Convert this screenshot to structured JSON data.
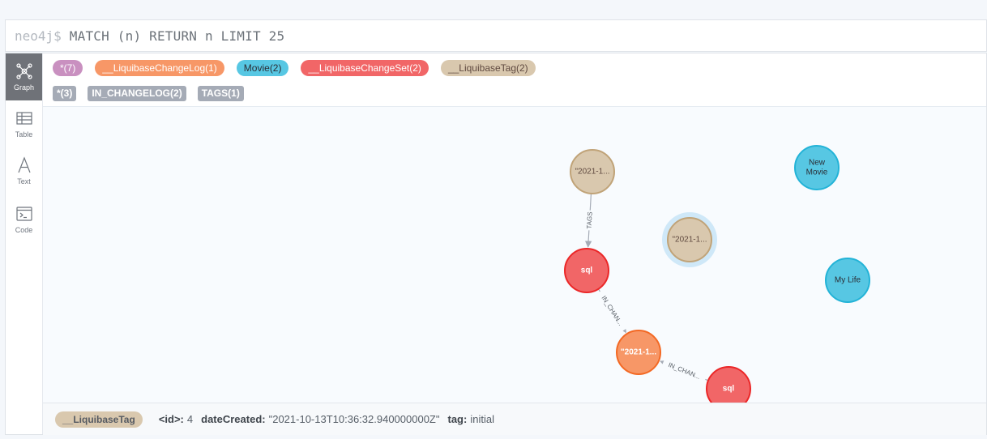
{
  "editor": {
    "prompt": "neo4j$",
    "query": "MATCH (n) RETURN n LIMIT 25"
  },
  "sidebar": {
    "modes": [
      {
        "label": "Graph",
        "icon": "graph-icon",
        "active": true
      },
      {
        "label": "Table",
        "icon": "table-icon",
        "active": false
      },
      {
        "label": "Text",
        "icon": "text-icon",
        "active": false
      },
      {
        "label": "Code",
        "icon": "code-icon",
        "active": false
      }
    ]
  },
  "labels": [
    {
      "name": "*",
      "count": "(7)",
      "bg": "#c990c0",
      "fg": "#ffffff"
    },
    {
      "name": "__LiquibaseChangeLog",
      "count": "(1)",
      "bg": "#f79767",
      "fg": "#ffffff"
    },
    {
      "name": "Movie",
      "count": "(2)",
      "bg": "#57c7e3",
      "fg": "#2a2c34"
    },
    {
      "name": "__LiquibaseChangeSet",
      "count": "(2)",
      "bg": "#f16667",
      "fg": "#ffffff"
    },
    {
      "name": "__LiquibaseTag",
      "count": "(2)",
      "bg": "#d9c8ae",
      "fg": "#604a40"
    }
  ],
  "relationships": [
    {
      "name": "*",
      "count": "(3)"
    },
    {
      "name": "IN_CHANGELOG",
      "count": "(2)"
    },
    {
      "name": "TAGS",
      "count": "(1)"
    }
  ],
  "graph": {
    "nodes": [
      {
        "id": "tag1",
        "caption": "\"2021-1...",
        "fill": "#d9c8ae",
        "stroke": "#c0a378",
        "text": "#604a40",
        "selected": false
      },
      {
        "id": "tag2",
        "caption": "\"2021-1...",
        "fill": "#d9c8ae",
        "stroke": "#c0a378",
        "text": "#604a40",
        "selected": true
      },
      {
        "id": "movie1",
        "caption": "New Movie",
        "fill": "#57c7e3",
        "stroke": "#23b3d7",
        "text": "#2a2c34",
        "selected": false
      },
      {
        "id": "movie2",
        "caption": "My Life",
        "fill": "#57c7e3",
        "stroke": "#23b3d7",
        "text": "#2a2c34",
        "selected": false
      },
      {
        "id": "set1",
        "caption": "sql",
        "fill": "#f16667",
        "stroke": "#eb2728",
        "text": "#ffffff",
        "selected": false
      },
      {
        "id": "log1",
        "caption": "\"2021-1...",
        "fill": "#f79767",
        "stroke": "#f36924",
        "text": "#ffffff",
        "selected": false
      },
      {
        "id": "set2",
        "caption": "sql",
        "fill": "#f16667",
        "stroke": "#eb2728",
        "text": "#ffffff",
        "selected": false
      }
    ],
    "edges": [
      {
        "from": "tag1",
        "to": "set1",
        "label": "TAGS"
      },
      {
        "from": "set1",
        "to": "log1",
        "label": "IN_CHAN..."
      },
      {
        "from": "set2",
        "to": "log1",
        "label": "IN_CHAN..."
      }
    ]
  },
  "details": {
    "label": "__LiquibaseTag",
    "props": [
      {
        "key": "<id>:",
        "value": "4"
      },
      {
        "key": "dateCreated:",
        "value": "\"2021-10-13T10:36:32.940000000Z\""
      },
      {
        "key": "tag:",
        "value": "initial"
      }
    ]
  }
}
